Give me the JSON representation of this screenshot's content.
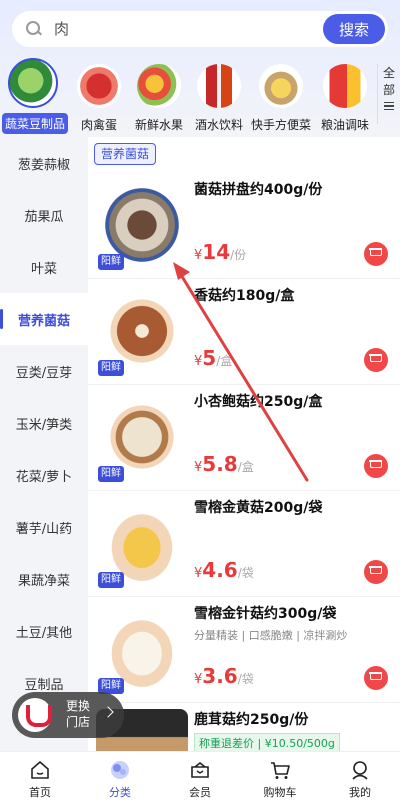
{
  "search": {
    "placeholder": "肉",
    "button": "搜索"
  },
  "top_categories": [
    {
      "label": "蔬菜豆制品",
      "icon": "vegetable-icon",
      "active": true
    },
    {
      "label": "肉禽蛋",
      "icon": "meat-icon"
    },
    {
      "label": "新鲜水果",
      "icon": "fruit-icon"
    },
    {
      "label": "酒水饮料",
      "icon": "drinks-icon"
    },
    {
      "label": "快手方便菜",
      "icon": "ready-meal-icon"
    },
    {
      "label": "粮油调味",
      "icon": "grain-oil-icon"
    }
  ],
  "all_categories": {
    "line1": "全",
    "line2": "部"
  },
  "sidebar": {
    "items": [
      {
        "label": "葱姜蒜椒"
      },
      {
        "label": "茄果瓜"
      },
      {
        "label": "叶菜"
      },
      {
        "label": "营养菌菇",
        "active": true
      },
      {
        "label": "豆类/豆芽"
      },
      {
        "label": "玉米/笋类"
      },
      {
        "label": "花菜/萝卜"
      },
      {
        "label": "薯芋/山药"
      },
      {
        "label": "果蔬净菜"
      },
      {
        "label": "土豆/其他"
      },
      {
        "label": "豆制品"
      }
    ]
  },
  "subcategory": "营养菌菇",
  "products": [
    {
      "name": "菌菇拼盘约400g/份",
      "tag": "阳鲜",
      "currency": "¥",
      "price": "14",
      "unit": "/份",
      "desc": ""
    },
    {
      "name": "香菇约180g/盒",
      "tag": "阳鲜",
      "currency": "¥",
      "price": "5",
      "unit": "/盒",
      "desc": ""
    },
    {
      "name": "小杏鲍菇约250g/盒",
      "tag": "阳鲜",
      "currency": "¥",
      "price": "5.8",
      "unit": "/盒",
      "desc": ""
    },
    {
      "name": "雪榕金黄菇200g/袋",
      "tag": "阳鲜",
      "currency": "¥",
      "price": "4.6",
      "unit": "/袋",
      "desc": ""
    },
    {
      "name": "雪榕金针菇约300g/袋",
      "tag": "阳鲜",
      "currency": "¥",
      "price": "3.6",
      "unit": "/袋",
      "desc": "分量精装 | 口感脆嫩 | 凉拌涮炒"
    },
    {
      "name": "鹿茸菇约250g/份",
      "tag": "",
      "currency": "",
      "price": "",
      "unit": "",
      "desc": ""
    }
  ],
  "last_badge": "称重退差价 | ¥10.50/500g",
  "store_switch": {
    "line1": "更换",
    "line2": "门店"
  },
  "tabbar": [
    {
      "label": "首页",
      "icon": "home-icon"
    },
    {
      "label": "分类",
      "icon": "category-icon",
      "active": true
    },
    {
      "label": "会员",
      "icon": "member-icon"
    },
    {
      "label": "购物车",
      "icon": "cart-icon"
    },
    {
      "label": "我的",
      "icon": "profile-icon"
    }
  ],
  "colors": {
    "accent": "#4b5ce6",
    "price": "#e83a3a"
  }
}
